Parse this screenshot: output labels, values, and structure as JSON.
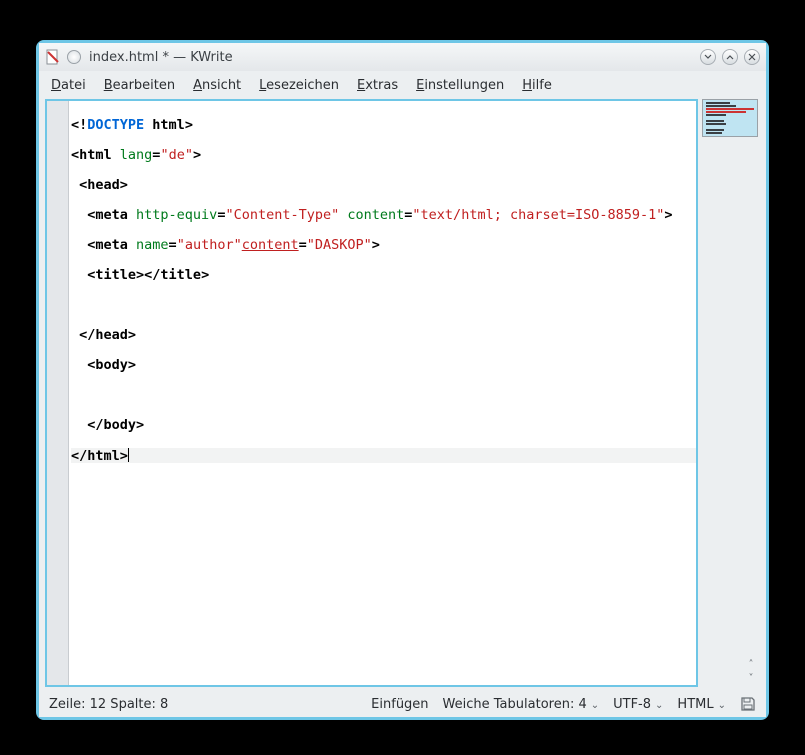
{
  "title": "index.html * — KWrite",
  "menus": {
    "datei": "Datei",
    "bearbeiten": "Bearbeiten",
    "ansicht": "Ansicht",
    "lesezeichen": "Lesezeichen",
    "extras": "Extras",
    "einstellungen": "Einstellungen",
    "hilfe": "Hilfe"
  },
  "code": {
    "l1a": "<!",
    "l1b": "DOCTYPE",
    "l1c": " html",
    "l1d": ">",
    "l2a": "<",
    "l2b": "html",
    "l2c": " lang",
    "l2d": "=",
    "l2e": "\"de\"",
    "l2f": ">",
    "l3a": " <",
    "l3b": "head",
    "l3c": ">",
    "l4a": "  <",
    "l4b": "meta",
    "l4c": " http-equiv",
    "l4d": "=",
    "l4e": "\"Content-Type\"",
    "l4f": " content",
    "l4g": "=",
    "l4h": "\"text/html; charset=ISO-8859-1\"",
    "l4i": ">",
    "l5a": "  <",
    "l5b": "meta",
    "l5c": " name",
    "l5d": "=",
    "l5e": "\"author\"",
    "l5f": "content",
    "l5g": "=",
    "l5h": "\"DASKOP\"",
    "l5i": ">",
    "l6a": "  <",
    "l6b": "title",
    "l6c": "></",
    "l6d": "title",
    "l6e": ">",
    "l7": "",
    "l8a": " </",
    "l8b": "head",
    "l8c": ">",
    "l9a": "  <",
    "l9b": "body",
    "l9c": ">",
    "l10": "",
    "l11a": "  </",
    "l11b": "body",
    "l11c": ">",
    "l12a": "</",
    "l12b": "html",
    "l12c": ">"
  },
  "status": {
    "position": "Zeile: 12 Spalte: 8",
    "insert": "Einfügen",
    "tabs": "Weiche Tabulatoren: 4",
    "encoding": "UTF-8",
    "mode": "HTML"
  }
}
